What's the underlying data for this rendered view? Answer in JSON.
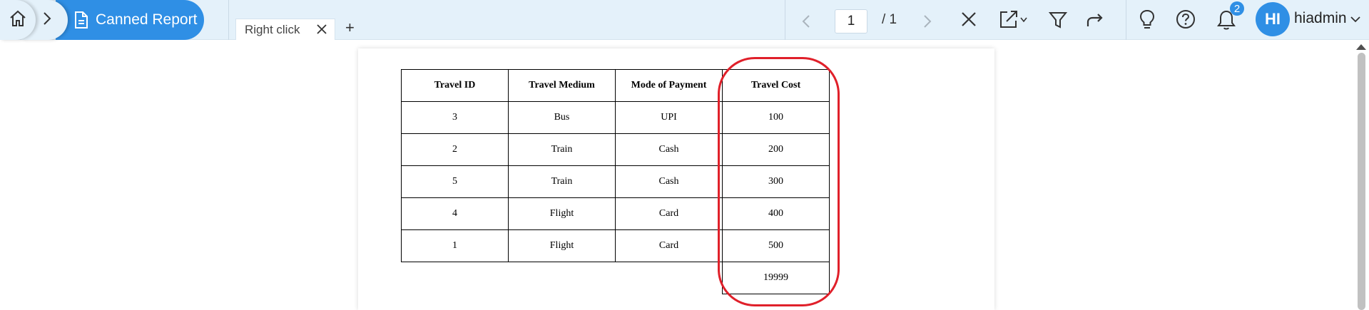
{
  "breadcrumb": {
    "report_name": "Canned Report"
  },
  "tabs": [
    {
      "label": "Right click"
    }
  ],
  "add_tab_label": "+",
  "pager": {
    "current_page": "1",
    "total": "/ 1"
  },
  "notifications": {
    "count": "2"
  },
  "user": {
    "initials": "HI",
    "name": "hiadmin"
  },
  "table": {
    "headers": [
      "Travel ID",
      "Travel Medium",
      "Mode of Payment",
      "Travel Cost"
    ],
    "rows": [
      [
        "3",
        "Bus",
        "UPI",
        "100"
      ],
      [
        "2",
        "Train",
        "Cash",
        "200"
      ],
      [
        "5",
        "Train",
        "Cash",
        "300"
      ],
      [
        "4",
        "Flight",
        "Card",
        "400"
      ],
      [
        "1",
        "Flight",
        "Card",
        "500"
      ]
    ],
    "total": "19999"
  },
  "colors": {
    "accent": "#2f8fe5",
    "topbar": "#e4f1fa",
    "highlight": "#e0202a"
  },
  "icons": [
    "home-icon",
    "chevron-right-icon",
    "document-icon",
    "close-icon",
    "chevron-left-icon",
    "export-icon",
    "filter-icon",
    "share-icon",
    "lightbulb-icon",
    "help-icon",
    "bell-icon",
    "chevron-down-icon"
  ]
}
